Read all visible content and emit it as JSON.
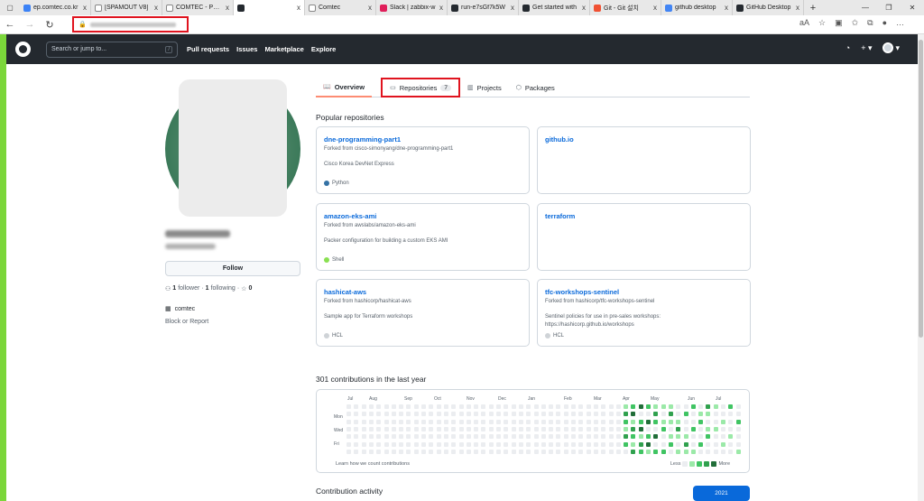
{
  "browser": {
    "tabs": [
      {
        "title": "ep.comtec.co.kr",
        "color": "#3b82f6"
      },
      {
        "title": "[SPAMOUT V8]",
        "color": "#ffffff"
      },
      {
        "title": "COMTEC - Porta",
        "color": "#ffffff"
      },
      {
        "title": "",
        "color": "#24292f",
        "active": true
      },
      {
        "title": "Comtec",
        "color": "#ffffff"
      },
      {
        "title": "Slack | zabbix-w",
        "color": "#e01e5a"
      },
      {
        "title": "run-e7sGf7k5W",
        "color": "#24292f"
      },
      {
        "title": "Get started with",
        "color": "#24292f"
      },
      {
        "title": "Git - Git 설치",
        "color": "#f05133"
      },
      {
        "title": "github desktop",
        "color": "#4285f4"
      },
      {
        "title": "GitHub Desktop",
        "color": "#24292f"
      }
    ],
    "new_tab": "+",
    "close_glyph": "x",
    "nav": {
      "back": "←",
      "forward": "→",
      "reload": "↻"
    },
    "window": {
      "minimize": "—",
      "maximize": "❐",
      "close": "✕"
    }
  },
  "github": {
    "search_placeholder": "Search or jump to...",
    "search_key": "/",
    "nav": [
      "Pull requests",
      "Issues",
      "Marketplace",
      "Explore"
    ],
    "icons": {
      "bell": "🔔",
      "plus": "+ ▾",
      "avatar": "▾"
    }
  },
  "profile": {
    "follow_label": "Follow",
    "followers_count": "1",
    "followers_label": "follower",
    "following_count": "1",
    "following_label": "following",
    "stars_count": "0",
    "organization": "comtec",
    "block_label": "Block or Report"
  },
  "tabs": {
    "overview": "Overview",
    "repositories": "Repositories",
    "repositories_count": "7",
    "projects": "Projects",
    "packages": "Packages"
  },
  "popular": {
    "title": "Popular repositories",
    "repos": [
      {
        "name": "dne-programming-part1",
        "fork": "Forked from cisco-simonyang/dne-programming-part1",
        "desc": "Cisco Korea DevNet Express",
        "lang": "Python",
        "lang_color": "#3572A5"
      },
      {
        "name": "github.io",
        "fork": "",
        "desc": "",
        "lang": "",
        "lang_color": ""
      },
      {
        "name": "amazon-eks-ami",
        "fork": "Forked from awslabs/amazon-eks-ami",
        "desc": "Packer configuration for building a custom EKS AMI",
        "lang": "Shell",
        "lang_color": "#89e051"
      },
      {
        "name": "terraform",
        "fork": "",
        "desc": "",
        "lang": "",
        "lang_color": ""
      },
      {
        "name": "hashicat-aws",
        "fork": "Forked from hashicorp/hashicat-aws",
        "desc": "Sample app for Terraform workshops",
        "lang": "HCL",
        "lang_color": "#cfd3d7"
      },
      {
        "name": "tfc-workshops-sentinel",
        "fork": "Forked from hashicorp/tfc-workshops-sentinel",
        "desc": "Sentinel policies for use in pre-sales workshops: https://hashicorp.github.io/workshops",
        "lang": "HCL",
        "lang_color": "#cfd3d7"
      }
    ]
  },
  "contributions": {
    "title": "301 contributions in the last year",
    "months": [
      "Jul",
      "Aug",
      "Sep",
      "Oct",
      "Nov",
      "Dec",
      "Jan",
      "Feb",
      "Mar",
      "Apr",
      "May",
      "Jun",
      "Jul"
    ],
    "days": [
      "Mon",
      "Wed",
      "Fri"
    ],
    "learn": "Learn how we count contributions",
    "less": "Less",
    "more": "More",
    "colors": [
      "#ebedf0",
      "#9be9a8",
      "#40c463",
      "#30a14e",
      "#216e39"
    ]
  },
  "activity": {
    "title": "Contribution activity",
    "year": "2021"
  }
}
